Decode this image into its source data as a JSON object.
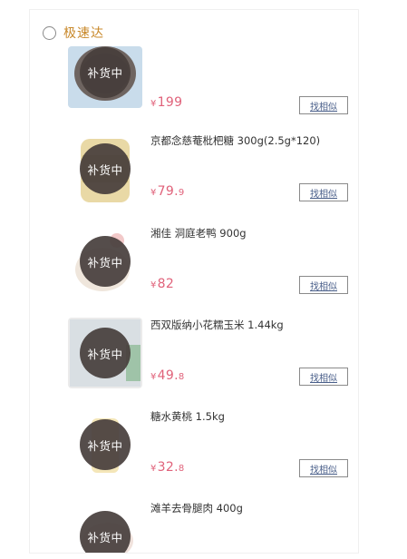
{
  "section": {
    "title": "极速达"
  },
  "colors": {
    "section_title": "#c8882a",
    "price": "#e0627a",
    "badge_bg": "#4a3f3d"
  },
  "items": [
    {
      "title": "",
      "price_yen": "¥",
      "price_int": "199",
      "price_dec": "",
      "badge": "补货中",
      "similar": "找相似"
    },
    {
      "title": "京都念慈菴枇杷糖 300g(2.5g*120)",
      "price_yen": "¥",
      "price_int": "79.",
      "price_dec": "9",
      "badge": "补货中",
      "similar": "找相似"
    },
    {
      "title": "湘佳 洞庭老鸭 900g",
      "price_yen": "¥",
      "price_int": "82",
      "price_dec": "",
      "badge": "补货中",
      "similar": "找相似"
    },
    {
      "title": "西双版纳小花糯玉米 1.44kg",
      "price_yen": "¥",
      "price_int": "49.",
      "price_dec": "8",
      "badge": "补货中",
      "similar": "找相似"
    },
    {
      "title": "糖水黄桃 1.5kg",
      "price_yen": "¥",
      "price_int": "32.",
      "price_dec": "8",
      "badge": "补货中",
      "similar": "找相似"
    },
    {
      "title": "滩羊去骨腿肉 400g",
      "price_yen": "",
      "price_int": "",
      "price_dec": "",
      "badge": "补货中",
      "similar": ""
    }
  ]
}
